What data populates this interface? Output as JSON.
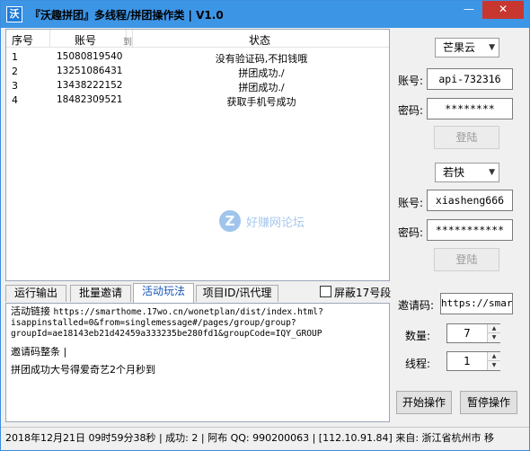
{
  "window": {
    "title": "『沃趣拼团』多线程/拼团操作类 | V1.0",
    "minimize_glyph": "—",
    "close_glyph": "✕",
    "app_icon_glyph": "沃"
  },
  "table": {
    "columns": [
      "序号",
      "账号",
      "到",
      "状态"
    ],
    "rows": [
      {
        "no": "1",
        "account": "15080819540",
        "status": "没有验证码,不扣钱哦"
      },
      {
        "no": "2",
        "account": "13251086431",
        "status": "拼团成功./"
      },
      {
        "no": "3",
        "account": "13438222152",
        "status": "拼团成功./"
      },
      {
        "no": "4",
        "account": "18482309521",
        "status": "获取手机号成功"
      }
    ]
  },
  "watermark": {
    "mark": "Z",
    "text": "好赚网论坛"
  },
  "tabs": [
    {
      "label": "运行输出"
    },
    {
      "label": "批量邀请"
    },
    {
      "label": "活动玩法"
    },
    {
      "label": "项目ID/讯代理"
    }
  ],
  "mask_checkbox": {
    "label": "屏蔽17号段",
    "checked": false
  },
  "activity": {
    "link_prefix": "活动链接",
    "line1": "https://smarthome.17wo.cn/wonetplan/dist/index.html?",
    "line2": "isappinstalled=0&from=singlemessage#/pages/group/group?",
    "line3": "groupId=ae18143eb21d42459a333235be280fd1&groupCode=IQY_GROUP",
    "invite_note": "邀请码整条 |",
    "promo": "拼团成功大号得爱奇艺2个月秒到"
  },
  "platform1": {
    "selected": "芒果云",
    "account_label": "账号:",
    "account_value": "api-732316",
    "password_label": "密码:",
    "password_value": "********",
    "login_label": "登陆"
  },
  "platform2": {
    "selected": "若快",
    "account_label": "账号:",
    "account_value": "xiasheng666",
    "password_label": "密码:",
    "password_value": "***********",
    "login_label": "登陆"
  },
  "invite": {
    "label": "邀请码:",
    "value": "https://smart"
  },
  "quantity": {
    "label": "数量:",
    "value": "7"
  },
  "threads": {
    "label": "线程:",
    "value": "1"
  },
  "actions": {
    "start": "开始操作",
    "pause": "暂停操作"
  },
  "status": {
    "text": "2018年12月21日 09时59分38秒 | 成功: 2 |   阿布 QQ: 990200063 | [112.10.91.84] 来自: 浙江省杭州市 移"
  }
}
